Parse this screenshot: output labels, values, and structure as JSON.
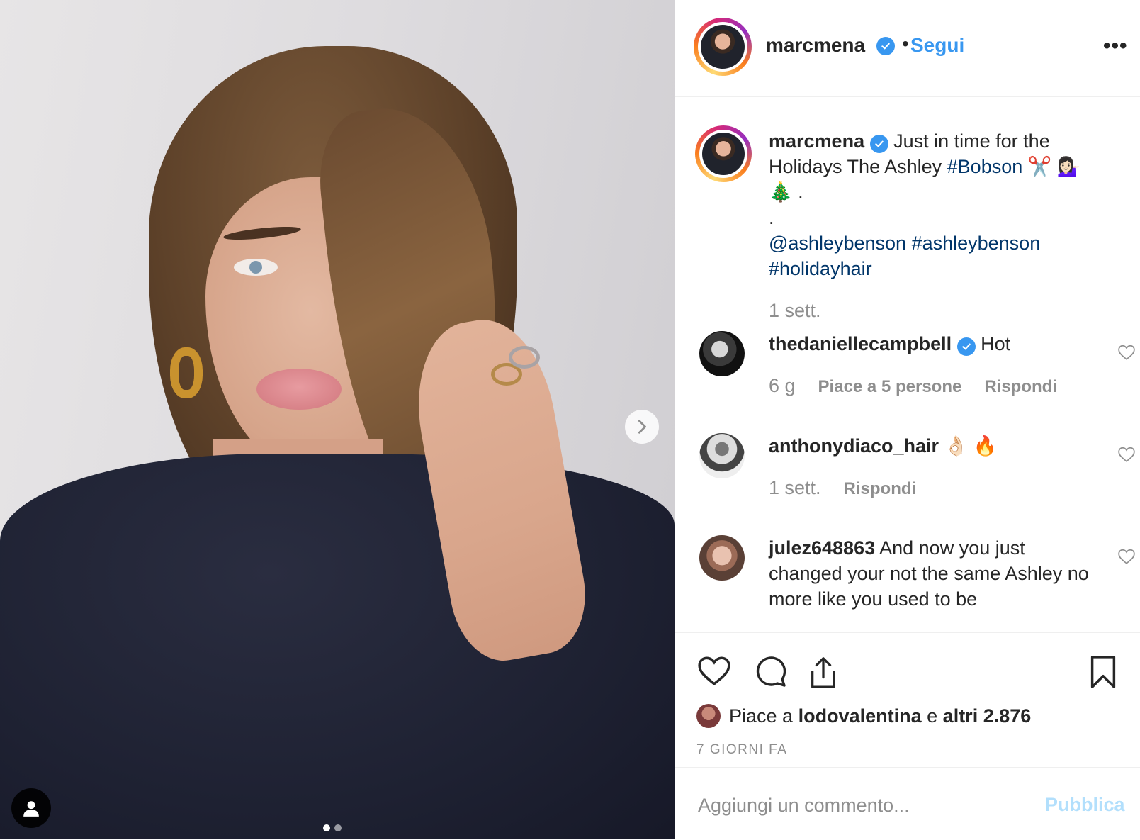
{
  "post": {
    "author": "marcmena",
    "follow_label": "Segui",
    "separator": "•",
    "more_label": "•••",
    "image_dots": 2,
    "active_dot": 0
  },
  "caption": {
    "username": "marcmena",
    "text": "Just in time for the Holidays The Ashley",
    "hashtag_bobson": "#Bobson",
    "emojis": "✂️ 💁🏻‍♀️",
    "tree_line": "🎄 .",
    "dot_line": ".",
    "mention": "@ashleybenson",
    "hashtag_ab": "#ashleybenson",
    "hashtag_hh": "#holidayhair",
    "time": "1 sett."
  },
  "comments": [
    {
      "username": "thedaniellecampbell",
      "verified": true,
      "text": "Hot",
      "time": "6 g",
      "likes": "Piace a 5 persone",
      "reply": "Rispondi"
    },
    {
      "username": "anthonydiaco_hair",
      "verified": false,
      "text": "👌🏻 🔥",
      "time": "1 sett.",
      "likes": "",
      "reply": "Rispondi"
    },
    {
      "username": "julez648863",
      "verified": false,
      "text": "And now you just changed your not the same Ashley no more like you used to be",
      "time": "",
      "likes": "",
      "reply": ""
    }
  ],
  "likes": {
    "prefix": "Piace a",
    "user": "lodovalentina",
    "conj": "e",
    "others": "altri 2.876"
  },
  "date": "7 GIORNI FA",
  "add_comment": {
    "placeholder": "Aggiungi un commento...",
    "publish": "Pubblica"
  },
  "colors": {
    "link": "#003569",
    "accent": "#3897f0",
    "muted": "#8e8e8e",
    "publish_disabled": "#b2dffc"
  },
  "icons": [
    "verified-badge-icon",
    "more-options-icon",
    "heart-icon",
    "comment-icon",
    "share-icon",
    "bookmark-icon",
    "chevron-right-icon",
    "user-tag-icon"
  ]
}
